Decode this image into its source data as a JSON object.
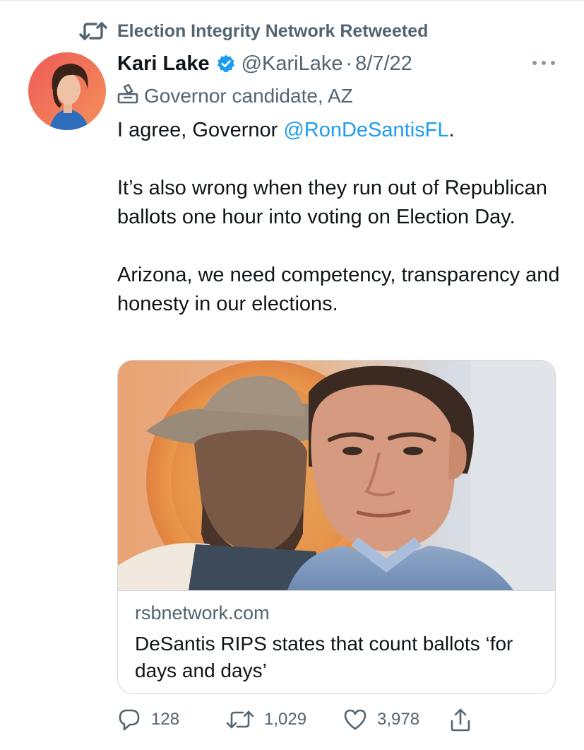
{
  "retweet_context": "Election Integrity Network Retweeted",
  "author": {
    "name": "Kari Lake",
    "handle": "@KariLake",
    "separator": "·",
    "date": "8/7/22",
    "label": "Governor candidate, AZ"
  },
  "tweet": {
    "line1_prefix": "I agree, Governor ",
    "line1_mention": "@RonDeSantisFL",
    "line1_suffix": ".",
    "paragraph2": "It’s also wrong when they run out of Republican ballots one hour into voting on Election Day.",
    "paragraph3": "Arizona, we need competency, transparency and honesty in our elections."
  },
  "card": {
    "domain": "rsbnetwork.com",
    "title": "DeSantis RIPS states that count ballots ‘for days and days’"
  },
  "metrics": {
    "replies": "128",
    "retweets": "1,029",
    "likes": "3,978"
  },
  "colors": {
    "accent": "#1d9bf0",
    "secondary_text": "#536471",
    "primary_text": "#0f1419",
    "border": "#cfd9de"
  },
  "icons": [
    "retweet-icon",
    "verified-badge-icon",
    "more-icon",
    "ballot-box-icon",
    "reply-icon",
    "like-icon",
    "share-icon"
  ]
}
